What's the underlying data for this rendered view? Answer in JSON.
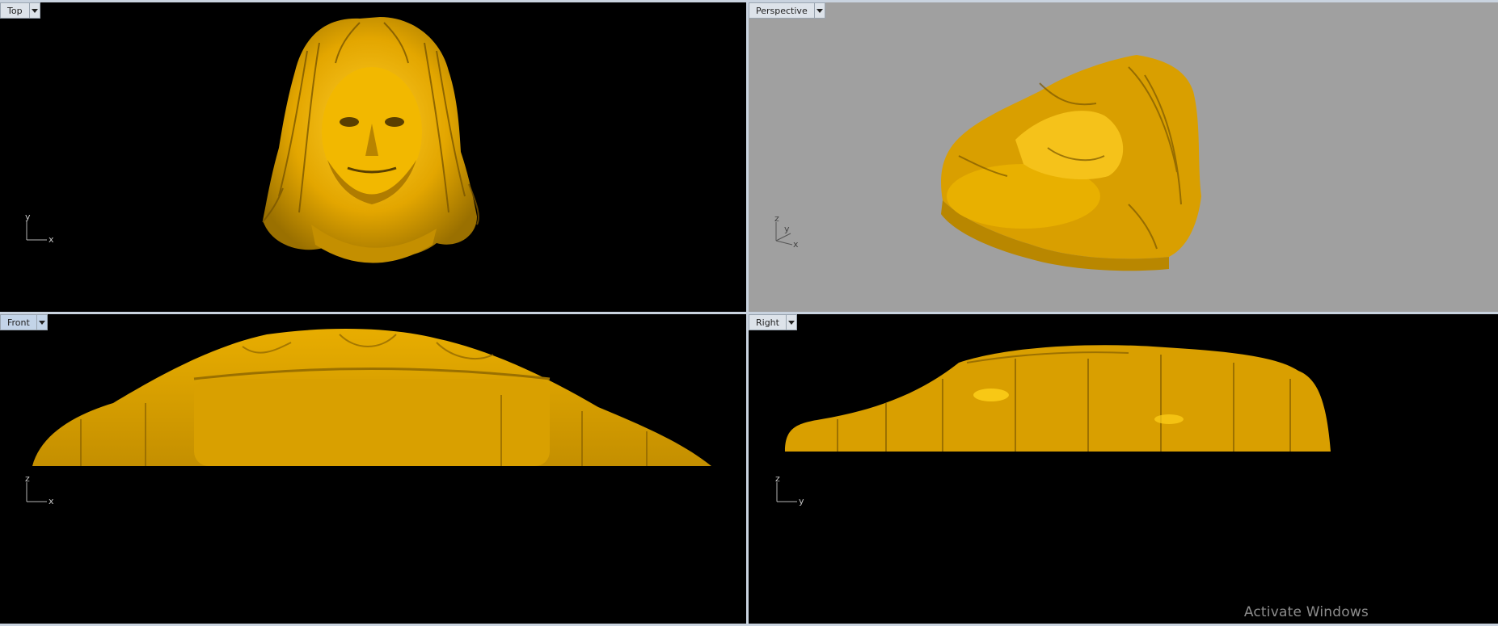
{
  "viewports": {
    "top": {
      "label": "Top",
      "axis_h": "x",
      "axis_v": "y"
    },
    "perspective": {
      "label": "Perspective",
      "axis_x": "x",
      "axis_y": "y",
      "axis_z": "z"
    },
    "front": {
      "label": "Front",
      "axis_h": "x",
      "axis_v": "z"
    },
    "right": {
      "label": "Right",
      "axis_h": "y",
      "axis_v": "z"
    }
  },
  "active_viewport": "Front",
  "model": {
    "material_color": "#e0a800",
    "highlight_color": "#ffd21a",
    "shadow_color": "#6b4e00"
  },
  "colors": {
    "viewport_dark": "#000000",
    "viewport_perspective": "#a0a0a0",
    "frame": "#c9d3df"
  },
  "os_watermark": "Activate Windows"
}
